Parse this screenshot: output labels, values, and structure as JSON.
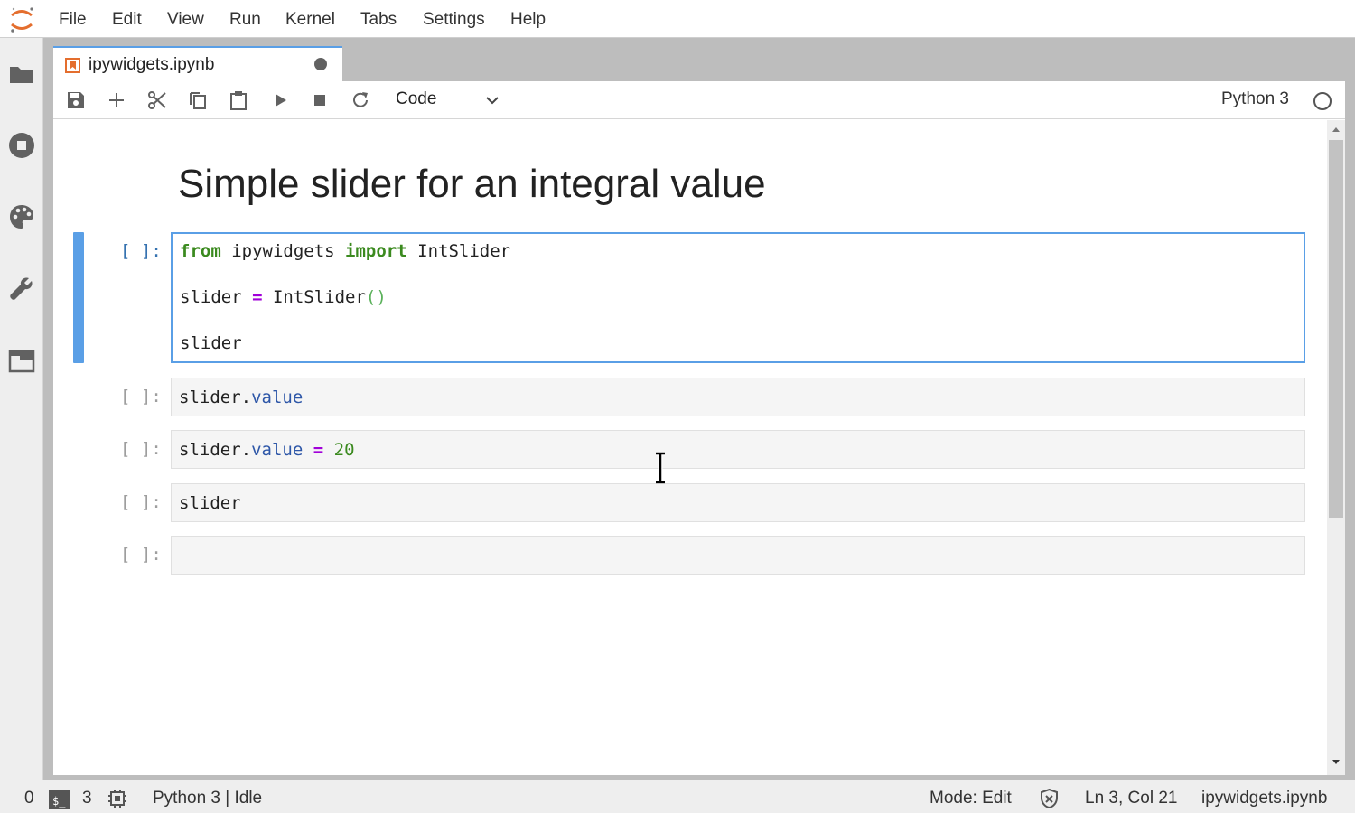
{
  "menu": {
    "items": [
      "File",
      "Edit",
      "View",
      "Run",
      "Kernel",
      "Tabs",
      "Settings",
      "Help"
    ]
  },
  "sidebar": {
    "icons": [
      "folder-icon",
      "running-icon",
      "palette-icon",
      "wrench-icon",
      "tabs-icon"
    ]
  },
  "tab": {
    "title": "ipywidgets.ipynb",
    "unsaved": true
  },
  "toolbar": {
    "buttons": [
      "save",
      "insert-cell",
      "cut",
      "copy",
      "paste",
      "run",
      "interrupt",
      "restart"
    ],
    "cell_type": "Code",
    "kernel_name": "Python 3"
  },
  "notebook": {
    "heading": "Simple slider for an integral value",
    "cells": [
      {
        "prompt": "[ ]:",
        "active": true,
        "lines": [
          "from ipywidgets import IntSlider",
          "",
          "slider = IntSlider()",
          "",
          "slider"
        ]
      },
      {
        "prompt": "[ ]:",
        "lines": [
          "slider.value"
        ]
      },
      {
        "prompt": "[ ]:",
        "lines": [
          "slider.value = 20"
        ]
      },
      {
        "prompt": "[ ]:",
        "lines": [
          "slider"
        ]
      },
      {
        "prompt": "[ ]:",
        "lines": [
          ""
        ]
      }
    ]
  },
  "status": {
    "terminals_count": "0",
    "kernels_count": "3",
    "kernel_state": "Python 3 | Idle",
    "mode": "Mode: Edit",
    "cursor_position": "Ln 3, Col 21",
    "file_name": "ipywidgets.ipynb"
  },
  "colors": {
    "accent": "#5a9fe6",
    "logo": "#e46e2e",
    "keyword": "#3b8a1f",
    "operator": "#a100d9"
  }
}
